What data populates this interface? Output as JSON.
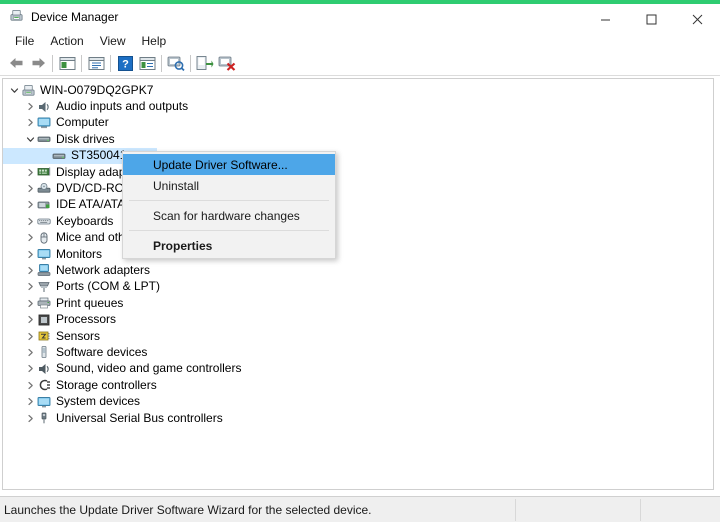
{
  "window": {
    "title": "Device Manager",
    "app_icon": "device-manager-icon",
    "accent_color": "#2ecc71",
    "controls": {
      "minimize": "minimize-icon",
      "maximize": "maximize-icon",
      "close": "close-icon"
    }
  },
  "menubar": {
    "items": [
      {
        "label": "File"
      },
      {
        "label": "Action"
      },
      {
        "label": "View"
      },
      {
        "label": "Help"
      }
    ]
  },
  "toolbar": {
    "buttons": [
      {
        "name": "back-arrow-icon",
        "tip": "Back"
      },
      {
        "name": "forward-arrow-icon",
        "tip": "Forward"
      },
      {
        "name": "show-hide-console-tree-icon",
        "tip": "Show/Hide console tree"
      },
      {
        "name": "properties-icon",
        "tip": "Properties"
      },
      {
        "name": "help-icon",
        "tip": "Help"
      },
      {
        "name": "view-detail-icon",
        "tip": "View"
      },
      {
        "name": "scan-hardware-changes-icon",
        "tip": "Scan for hardware changes"
      },
      {
        "name": "update-driver-software-icon",
        "tip": "Update Driver Software"
      },
      {
        "name": "uninstall-device-icon",
        "tip": "Uninstall"
      }
    ]
  },
  "tree": {
    "root": {
      "label": "WIN-O079DQ2GPK7",
      "icon": "computer-root-icon",
      "expanded": true
    },
    "items": [
      {
        "label": "Audio inputs and outputs",
        "icon": "audio-icon",
        "level": 1,
        "expanded": false,
        "selected": false
      },
      {
        "label": "Computer",
        "icon": "computer-icon",
        "level": 1,
        "expanded": false,
        "selected": false
      },
      {
        "label": "Disk drives",
        "icon": "disk-drive-icon",
        "level": 1,
        "expanded": true,
        "selected": false
      },
      {
        "label": "ST350041",
        "icon": "disk-drive-icon",
        "level": 2,
        "expanded": null,
        "selected": true
      },
      {
        "label": "Display adapters",
        "icon": "display-adapter-icon",
        "level": 1,
        "expanded": false,
        "selected": false
      },
      {
        "label": "DVD/CD-ROM drives",
        "icon": "dvd-drive-icon",
        "level": 1,
        "expanded": false,
        "selected": false
      },
      {
        "label": "IDE ATA/ATAPI controllers",
        "icon": "ide-controller-icon",
        "level": 1,
        "expanded": false,
        "selected": false
      },
      {
        "label": "Keyboards",
        "icon": "keyboard-icon",
        "level": 1,
        "expanded": false,
        "selected": false
      },
      {
        "label": "Mice and other pointing devices",
        "icon": "mouse-icon",
        "level": 1,
        "expanded": false,
        "selected": false
      },
      {
        "label": "Monitors",
        "icon": "monitor-icon",
        "level": 1,
        "expanded": false,
        "selected": false
      },
      {
        "label": "Network adapters",
        "icon": "network-adapter-icon",
        "level": 1,
        "expanded": false,
        "selected": false
      },
      {
        "label": "Ports (COM & LPT)",
        "icon": "port-icon",
        "level": 1,
        "expanded": false,
        "selected": false
      },
      {
        "label": "Print queues",
        "icon": "printer-icon",
        "level": 1,
        "expanded": false,
        "selected": false
      },
      {
        "label": "Processors",
        "icon": "processor-icon",
        "level": 1,
        "expanded": false,
        "selected": false
      },
      {
        "label": "Sensors",
        "icon": "sensor-icon",
        "level": 1,
        "expanded": false,
        "selected": false
      },
      {
        "label": "Software devices",
        "icon": "software-device-icon",
        "level": 1,
        "expanded": false,
        "selected": false
      },
      {
        "label": "Sound, video and game controllers",
        "icon": "sound-icon",
        "level": 1,
        "expanded": false,
        "selected": false
      },
      {
        "label": "Storage controllers",
        "icon": "storage-controller-icon",
        "level": 1,
        "expanded": false,
        "selected": false
      },
      {
        "label": "System devices",
        "icon": "system-device-icon",
        "level": 1,
        "expanded": false,
        "selected": false
      },
      {
        "label": "Universal Serial Bus controllers",
        "icon": "usb-controller-icon",
        "level": 1,
        "expanded": false,
        "selected": false
      }
    ]
  },
  "context_menu": {
    "items": [
      {
        "label": "Update Driver Software...",
        "highlighted": true,
        "bold": false,
        "separator_before": false
      },
      {
        "label": "Uninstall",
        "highlighted": false,
        "bold": false,
        "separator_before": false
      },
      {
        "label": "Scan for hardware changes",
        "highlighted": false,
        "bold": false,
        "separator_before": true
      },
      {
        "label": "Properties",
        "highlighted": false,
        "bold": true,
        "separator_before": true
      }
    ]
  },
  "statusbar": {
    "message": "Launches the Update Driver Software Wizard for the selected device.",
    "panel2": "",
    "panel3": ""
  }
}
